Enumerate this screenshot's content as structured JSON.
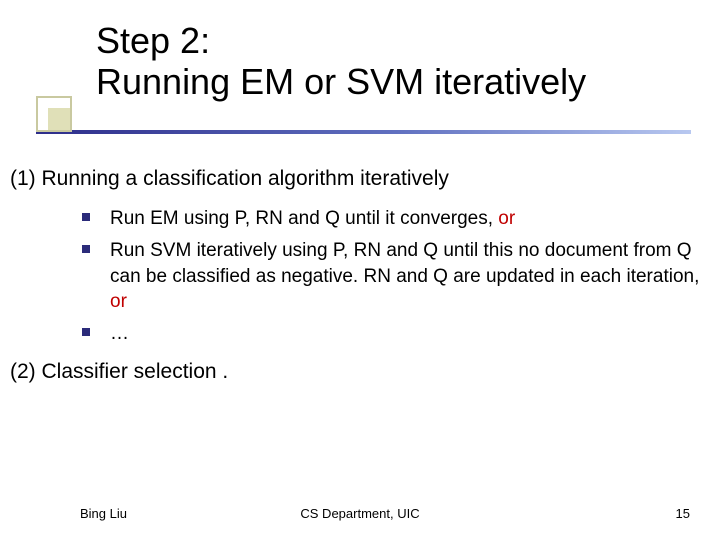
{
  "title": {
    "line1": "Step 2:",
    "line2": "Running EM or SVM iteratively"
  },
  "body": {
    "item1": "(1) Running a classification algorithm iteratively",
    "sub1_a": "Run EM using P, RN and Q until it converges, ",
    "sub1_a_red": "or",
    "sub2_a": "Run SVM iteratively using P, RN and Q until this no document from Q can be classified as negative. RN and Q are updated in each iteration, ",
    "sub2_a_red": "or",
    "sub3": "…",
    "item2": "(2) Classifier selection ."
  },
  "footer": {
    "left": "Bing Liu",
    "center": "CS Department, UIC",
    "right": "15"
  }
}
